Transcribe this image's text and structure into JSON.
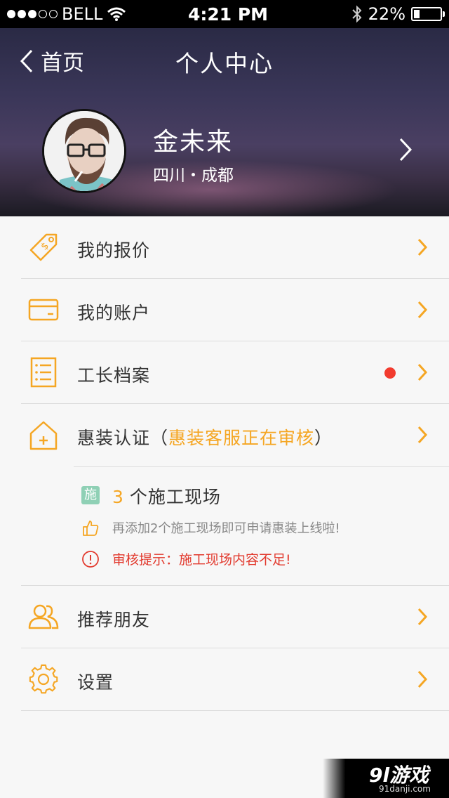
{
  "status_bar": {
    "carrier": "BELL",
    "time": "4:21 PM",
    "battery_percent": "22%",
    "battery_level": 0.22
  },
  "header": {
    "back_label": "首页",
    "title": "个人中心",
    "user": {
      "name": "金未来",
      "location": "四川・成都"
    }
  },
  "menu": {
    "quote": "我的报价",
    "account": "我的账户",
    "archive": "工长档案",
    "certify_prefix": "惠装认证（",
    "certify_status": "惠装客服正在审核",
    "certify_suffix": "）",
    "friends": "推荐朋友",
    "settings": "设置"
  },
  "certify_panel": {
    "badge": "施",
    "count": "3",
    "sites_label": "个施工现场",
    "hint": "再添加2个施工现场即可申请惠装上线啦!",
    "warning": "审核提示：施工现场内容不足!"
  },
  "watermark": {
    "logo": "9l游戏",
    "site": "91danji.com"
  },
  "colors": {
    "accent": "#f5a623",
    "alert": "#e23a2e",
    "badge": "#8fd0b5"
  }
}
